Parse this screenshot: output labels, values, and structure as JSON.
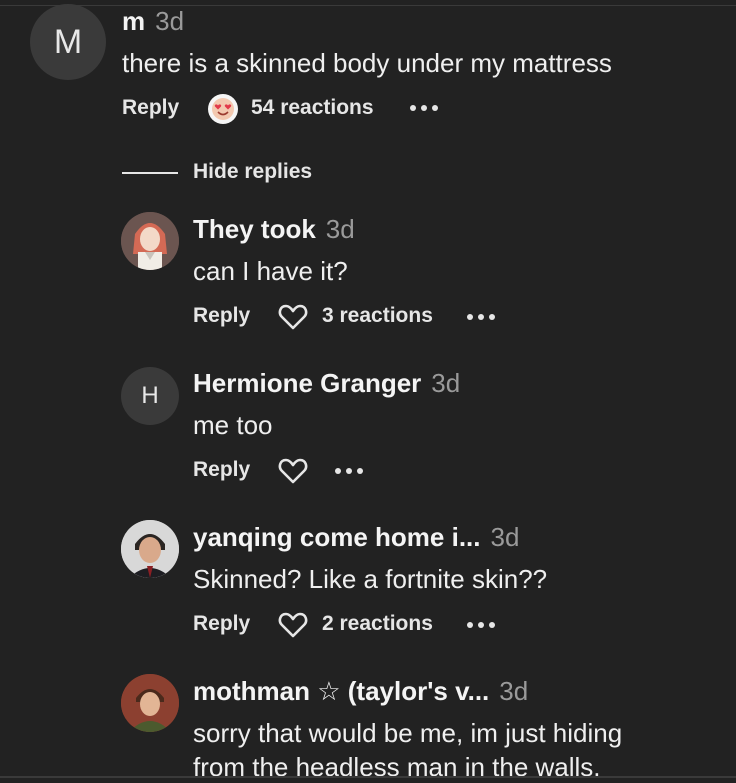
{
  "main_comment": {
    "avatar_letter": "M",
    "username": "m",
    "time": "3d",
    "text": "there is a skinned body under my mattress",
    "reply_label": "Reply",
    "reactions": "54 reactions",
    "reaction_icon": "heart-eyes-emoji-icon"
  },
  "hide_replies_label": "Hide replies",
  "replies": [
    {
      "username": "They took",
      "time": "3d",
      "text": "can I have it?",
      "reply_label": "Reply",
      "reactions": "3 reactions",
      "avatar": "illustrated-character-avatar"
    },
    {
      "avatar_letter": "H",
      "username": "Hermione Granger",
      "time": "3d",
      "text": "me too",
      "reply_label": "Reply"
    },
    {
      "username": "yanqing come home i...",
      "time": "3d",
      "text": "Skinned? Like a fortnite skin??",
      "reply_label": "Reply",
      "reactions": "2 reactions",
      "avatar": "man-portrait-avatar"
    },
    {
      "username": "mothman ☆ (taylor's v...",
      "time": "3d",
      "text_line1": "sorry that would be me, im just hiding",
      "text_line2": "from the headless man in the walls.",
      "avatar": "photo-avatar"
    }
  ],
  "colors": {
    "background": "#222222",
    "text": "#f2f2f2",
    "muted": "#9a9a9a",
    "avatar_bg": "#3a3a3a"
  }
}
